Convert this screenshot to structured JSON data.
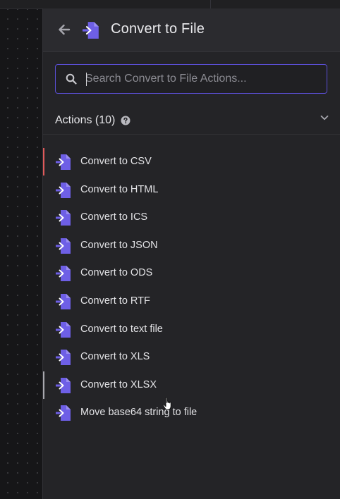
{
  "header": {
    "title": "Convert to File",
    "back_icon": "arrow-left-icon",
    "node_icon": "file-import-icon"
  },
  "search": {
    "placeholder": "Search Convert to File Actions...",
    "value": ""
  },
  "actions_section": {
    "title": "Actions (10)",
    "help_icon": "question-circle-icon",
    "collapse_icon": "chevron-down-icon"
  },
  "actions": [
    {
      "label": "Convert to CSV",
      "marker": "active"
    },
    {
      "label": "Convert to HTML",
      "marker": "none"
    },
    {
      "label": "Convert to ICS",
      "marker": "none"
    },
    {
      "label": "Convert to JSON",
      "marker": "none"
    },
    {
      "label": "Convert to ODS",
      "marker": "none"
    },
    {
      "label": "Convert to RTF",
      "marker": "none"
    },
    {
      "label": "Convert to text file",
      "marker": "none"
    },
    {
      "label": "Convert to XLS",
      "marker": "none"
    },
    {
      "label": "Convert to XLSX",
      "marker": "hover"
    },
    {
      "label": "Move base64 string to file",
      "marker": "none"
    }
  ],
  "colors": {
    "accent": "#5b4fd6",
    "icon_purple": "#6e5fe6",
    "active_marker": "#e05a5a",
    "hover_marker": "#a8a8ae",
    "panel_bg": "#242427",
    "text": "#e3e3e6"
  }
}
